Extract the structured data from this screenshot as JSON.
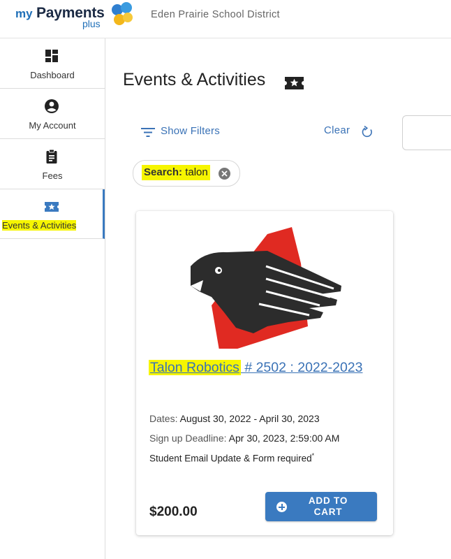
{
  "header": {
    "logo": {
      "my": "my",
      "payments": "Payments",
      "plus": "plus"
    },
    "district": "Eden Prairie School District"
  },
  "sidebar": {
    "items": [
      {
        "label": "Dashboard",
        "icon": "dashboard-icon"
      },
      {
        "label": "My Account",
        "icon": "account-circle-icon"
      },
      {
        "label": "Fees",
        "icon": "clipboard-icon"
      },
      {
        "label": "Events & Activities",
        "icon": "ticket-star-icon",
        "active": true
      }
    ]
  },
  "main": {
    "title": "Events & Activities",
    "show_filters": "Show Filters",
    "clear": "Clear",
    "search_chip": {
      "label": "Search:",
      "value": " talon"
    }
  },
  "card": {
    "title_highlight": "Talon Robotics",
    "title_rest": " # 2502 : 2022-2023",
    "dates_label": "Dates:",
    "dates_value": " August 30, 2022 - April 30, 2023",
    "deadline_label": "Sign up Deadline:",
    "deadline_value": " Apr 30, 2023, 2:59:00 AM",
    "requirement": "Student Email Update & Form required",
    "requirement_mark": "*",
    "price": "$200.00",
    "add_to_cart": "ADD TO CART"
  },
  "colors": {
    "accent": "#3a7ac0",
    "link": "#3a72b6",
    "highlight": "#f6f500",
    "logo_red": "#e02a22",
    "logo_dark": "#2c2c2c"
  }
}
